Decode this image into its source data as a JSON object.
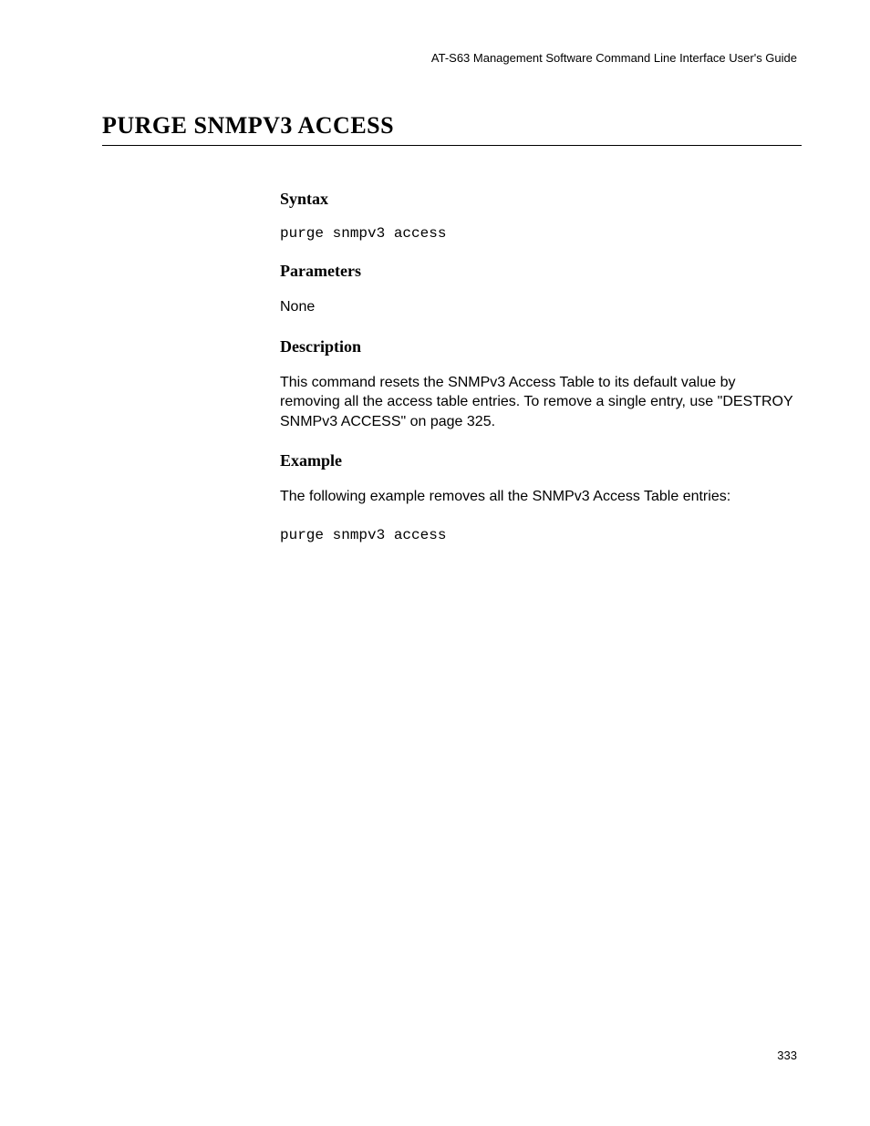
{
  "header": {
    "guide_title": "AT-S63 Management Software Command Line Interface User's Guide"
  },
  "title": "PURGE SNMPV3 ACCESS",
  "sections": {
    "syntax": {
      "heading": "Syntax",
      "code": "purge snmpv3 access"
    },
    "parameters": {
      "heading": "Parameters",
      "text": "None"
    },
    "description": {
      "heading": "Description",
      "text": "This command resets the SNMPv3 Access Table to its default value by removing all the access table entries. To remove a single entry, use \"DESTROY SNMPv3 ACCESS\" on page 325."
    },
    "example": {
      "heading": "Example",
      "text": "The following example removes all the SNMPv3 Access Table entries:",
      "code": "purge snmpv3 access"
    }
  },
  "page_number": "333"
}
